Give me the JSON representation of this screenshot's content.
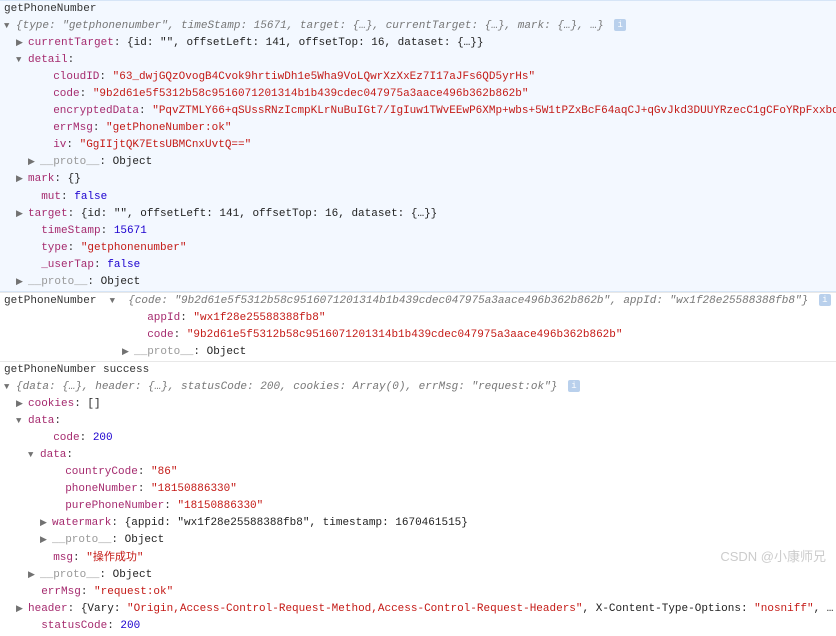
{
  "line1_label": "getPhoneNumber",
  "obj1_summary_pre": "{type: ",
  "obj1_type": "\"getphonenumber\"",
  "obj1_ts_key": "timeStamp",
  "obj1_ts_val": "15671",
  "obj1_rest": ", target: {…}, currentTarget: {…}, mark: {…}, …}",
  "currentTarget_key": "currentTarget",
  "currentTarget_val": "{id: \"\", offsetLeft: 141, offsetTop: 16, dataset: {…}}",
  "detail_key": "detail",
  "cloudID_key": "cloudID",
  "cloudID_val": "\"63_dwjGQzOvogB4Cvok9hrtiwDh1e5Wha9VoLQwrXzXxEz7I17aJFs6QD5yrHs\"",
  "code_key": "code",
  "code1_val": "\"9b2d61e5f5312b58c9516071201314b1b439cdec047975a3aace496b362b862b\"",
  "encData_key": "encryptedData",
  "encData_val": "\"PqvZTMLY66+qSUssRNzIcmpKLrNuBuIGt7/IgIuw1TWvEEwP6XMp+wbs+5W1tPZxBcF64aqCJ+qGvJkd3DUUYRzecC1gCFoYRpFxxbd",
  "errMsg_key": "errMsg",
  "errMsg1_val": "\"getPhoneNumber:ok\"",
  "iv_key": "iv",
  "iv_val": "\"GgIIjtQK7EtsUBMCnxUvtQ==\"",
  "proto_key": "__proto__",
  "proto_val": "Object",
  "mark_key": "mark",
  "mark_val": "{}",
  "mut_key": "mut",
  "mut_val": "false",
  "target_key": "target",
  "target_val": "{id: \"\", offsetLeft: 141, offsetTop: 16, dataset: {…}}",
  "timeStamp_key": "timeStamp",
  "timeStamp_val": "15671",
  "type_key": "type",
  "type_val": "\"getphonenumber\"",
  "userTap_key": "_userTap",
  "userTap_val": "false",
  "line2_label": "getPhoneNumber",
  "obj2_summary_pre": "{code: ",
  "obj2_code": "\"9b2d61e5f5312b58c9516071201314b1b439cdec047975a3aace496b362b862b\"",
  "obj2_appid_key": "appId",
  "obj2_appid_val": "\"wx1f28e25588388fb8\"",
  "appId_key": "appId",
  "appId_val": "\"wx1f28e25588388fb8\"",
  "code2_val": "\"9b2d61e5f5312b58c9516071201314b1b439cdec047975a3aace496b362b862b\"",
  "line3_label": "getPhoneNumber success",
  "obj3_summary": "{data: {…}, header: {…}, statusCode: 200, cookies: Array(0), errMsg: ",
  "obj3_errMsg": "\"request:ok\"",
  "obj3_close": "}",
  "cookies_key": "cookies",
  "cookies_val": "[]",
  "data_key": "data",
  "code200_key": "code",
  "code200_val": "200",
  "countryCode_key": "countryCode",
  "countryCode_val": "\"86\"",
  "phoneNumber_key": "phoneNumber",
  "phoneNumber_val": "\"18150886330\"",
  "purePhone_key": "purePhoneNumber",
  "purePhone_val": "\"18150886330\"",
  "watermark_key": "watermark",
  "watermark_val": "{appid: \"wx1f28e25588388fb8\", timestamp: 1670461515}",
  "msg_key": "msg",
  "msg_val": "\"操作成功\"",
  "errMsg2_val": "\"request:ok\"",
  "header_key": "header",
  "header_val_pre": "{Vary: ",
  "header_vary": "\"Origin,Access-Control-Request-Method,Access-Control-Request-Headers\"",
  "header_xcto": ", X-Content-Type-Options: ",
  "header_xcto_val": "\"nosniff\"",
  "statusCode_key": "statusCode",
  "statusCode_val": "200",
  "watermark_text": "CSDN @小康师兄"
}
